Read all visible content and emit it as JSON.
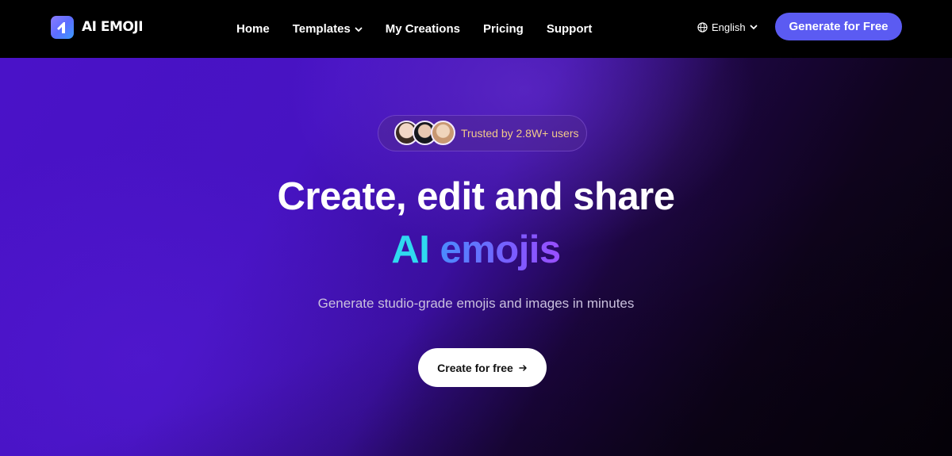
{
  "brand": {
    "name": "AI EMOJI"
  },
  "nav": {
    "items": [
      {
        "label": "Home"
      },
      {
        "label": "Templates"
      },
      {
        "label": "My Creations"
      },
      {
        "label": "Pricing"
      },
      {
        "label": "Support"
      }
    ],
    "language": "English",
    "cta_label": "Generate for Free"
  },
  "hero": {
    "badge_text": "Trusted by 2.8W+ users",
    "headline_line1": "Create, edit and share",
    "headline_ai": "AI",
    "headline_emojis": "emojis",
    "subtitle": "Generate studio-grade emojis and images in minutes",
    "cta_label": "Create for free"
  },
  "colors": {
    "accent": "#5b5bf2",
    "ai_cyan": "#2fd9f0",
    "badge_text": "#f1c98a"
  },
  "icons": [
    "logo-mark-icon",
    "chevron-down-icon",
    "globe-icon",
    "arrow-right-icon"
  ]
}
